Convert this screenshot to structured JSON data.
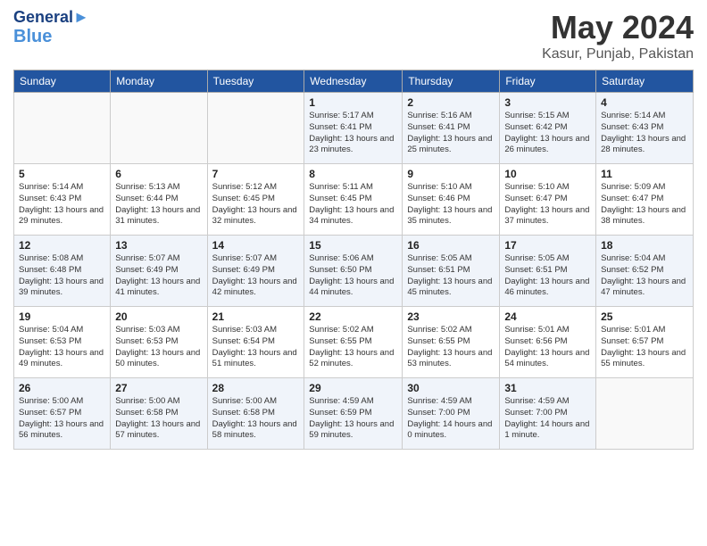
{
  "header": {
    "logo_line1": "General",
    "logo_line2": "Blue",
    "month": "May 2024",
    "location": "Kasur, Punjab, Pakistan"
  },
  "weekdays": [
    "Sunday",
    "Monday",
    "Tuesday",
    "Wednesday",
    "Thursday",
    "Friday",
    "Saturday"
  ],
  "weeks": [
    [
      {
        "day": "",
        "info": ""
      },
      {
        "day": "",
        "info": ""
      },
      {
        "day": "",
        "info": ""
      },
      {
        "day": "1",
        "info": "Sunrise: 5:17 AM\nSunset: 6:41 PM\nDaylight: 13 hours\nand 23 minutes."
      },
      {
        "day": "2",
        "info": "Sunrise: 5:16 AM\nSunset: 6:41 PM\nDaylight: 13 hours\nand 25 minutes."
      },
      {
        "day": "3",
        "info": "Sunrise: 5:15 AM\nSunset: 6:42 PM\nDaylight: 13 hours\nand 26 minutes."
      },
      {
        "day": "4",
        "info": "Sunrise: 5:14 AM\nSunset: 6:43 PM\nDaylight: 13 hours\nand 28 minutes."
      }
    ],
    [
      {
        "day": "5",
        "info": "Sunrise: 5:14 AM\nSunset: 6:43 PM\nDaylight: 13 hours\nand 29 minutes."
      },
      {
        "day": "6",
        "info": "Sunrise: 5:13 AM\nSunset: 6:44 PM\nDaylight: 13 hours\nand 31 minutes."
      },
      {
        "day": "7",
        "info": "Sunrise: 5:12 AM\nSunset: 6:45 PM\nDaylight: 13 hours\nand 32 minutes."
      },
      {
        "day": "8",
        "info": "Sunrise: 5:11 AM\nSunset: 6:45 PM\nDaylight: 13 hours\nand 34 minutes."
      },
      {
        "day": "9",
        "info": "Sunrise: 5:10 AM\nSunset: 6:46 PM\nDaylight: 13 hours\nand 35 minutes."
      },
      {
        "day": "10",
        "info": "Sunrise: 5:10 AM\nSunset: 6:47 PM\nDaylight: 13 hours\nand 37 minutes."
      },
      {
        "day": "11",
        "info": "Sunrise: 5:09 AM\nSunset: 6:47 PM\nDaylight: 13 hours\nand 38 minutes."
      }
    ],
    [
      {
        "day": "12",
        "info": "Sunrise: 5:08 AM\nSunset: 6:48 PM\nDaylight: 13 hours\nand 39 minutes."
      },
      {
        "day": "13",
        "info": "Sunrise: 5:07 AM\nSunset: 6:49 PM\nDaylight: 13 hours\nand 41 minutes."
      },
      {
        "day": "14",
        "info": "Sunrise: 5:07 AM\nSunset: 6:49 PM\nDaylight: 13 hours\nand 42 minutes."
      },
      {
        "day": "15",
        "info": "Sunrise: 5:06 AM\nSunset: 6:50 PM\nDaylight: 13 hours\nand 44 minutes."
      },
      {
        "day": "16",
        "info": "Sunrise: 5:05 AM\nSunset: 6:51 PM\nDaylight: 13 hours\nand 45 minutes."
      },
      {
        "day": "17",
        "info": "Sunrise: 5:05 AM\nSunset: 6:51 PM\nDaylight: 13 hours\nand 46 minutes."
      },
      {
        "day": "18",
        "info": "Sunrise: 5:04 AM\nSunset: 6:52 PM\nDaylight: 13 hours\nand 47 minutes."
      }
    ],
    [
      {
        "day": "19",
        "info": "Sunrise: 5:04 AM\nSunset: 6:53 PM\nDaylight: 13 hours\nand 49 minutes."
      },
      {
        "day": "20",
        "info": "Sunrise: 5:03 AM\nSunset: 6:53 PM\nDaylight: 13 hours\nand 50 minutes."
      },
      {
        "day": "21",
        "info": "Sunrise: 5:03 AM\nSunset: 6:54 PM\nDaylight: 13 hours\nand 51 minutes."
      },
      {
        "day": "22",
        "info": "Sunrise: 5:02 AM\nSunset: 6:55 PM\nDaylight: 13 hours\nand 52 minutes."
      },
      {
        "day": "23",
        "info": "Sunrise: 5:02 AM\nSunset: 6:55 PM\nDaylight: 13 hours\nand 53 minutes."
      },
      {
        "day": "24",
        "info": "Sunrise: 5:01 AM\nSunset: 6:56 PM\nDaylight: 13 hours\nand 54 minutes."
      },
      {
        "day": "25",
        "info": "Sunrise: 5:01 AM\nSunset: 6:57 PM\nDaylight: 13 hours\nand 55 minutes."
      }
    ],
    [
      {
        "day": "26",
        "info": "Sunrise: 5:00 AM\nSunset: 6:57 PM\nDaylight: 13 hours\nand 56 minutes."
      },
      {
        "day": "27",
        "info": "Sunrise: 5:00 AM\nSunset: 6:58 PM\nDaylight: 13 hours\nand 57 minutes."
      },
      {
        "day": "28",
        "info": "Sunrise: 5:00 AM\nSunset: 6:58 PM\nDaylight: 13 hours\nand 58 minutes."
      },
      {
        "day": "29",
        "info": "Sunrise: 4:59 AM\nSunset: 6:59 PM\nDaylight: 13 hours\nand 59 minutes."
      },
      {
        "day": "30",
        "info": "Sunrise: 4:59 AM\nSunset: 7:00 PM\nDaylight: 14 hours\nand 0 minutes."
      },
      {
        "day": "31",
        "info": "Sunrise: 4:59 AM\nSunset: 7:00 PM\nDaylight: 14 hours\nand 1 minute."
      },
      {
        "day": "",
        "info": ""
      }
    ]
  ]
}
